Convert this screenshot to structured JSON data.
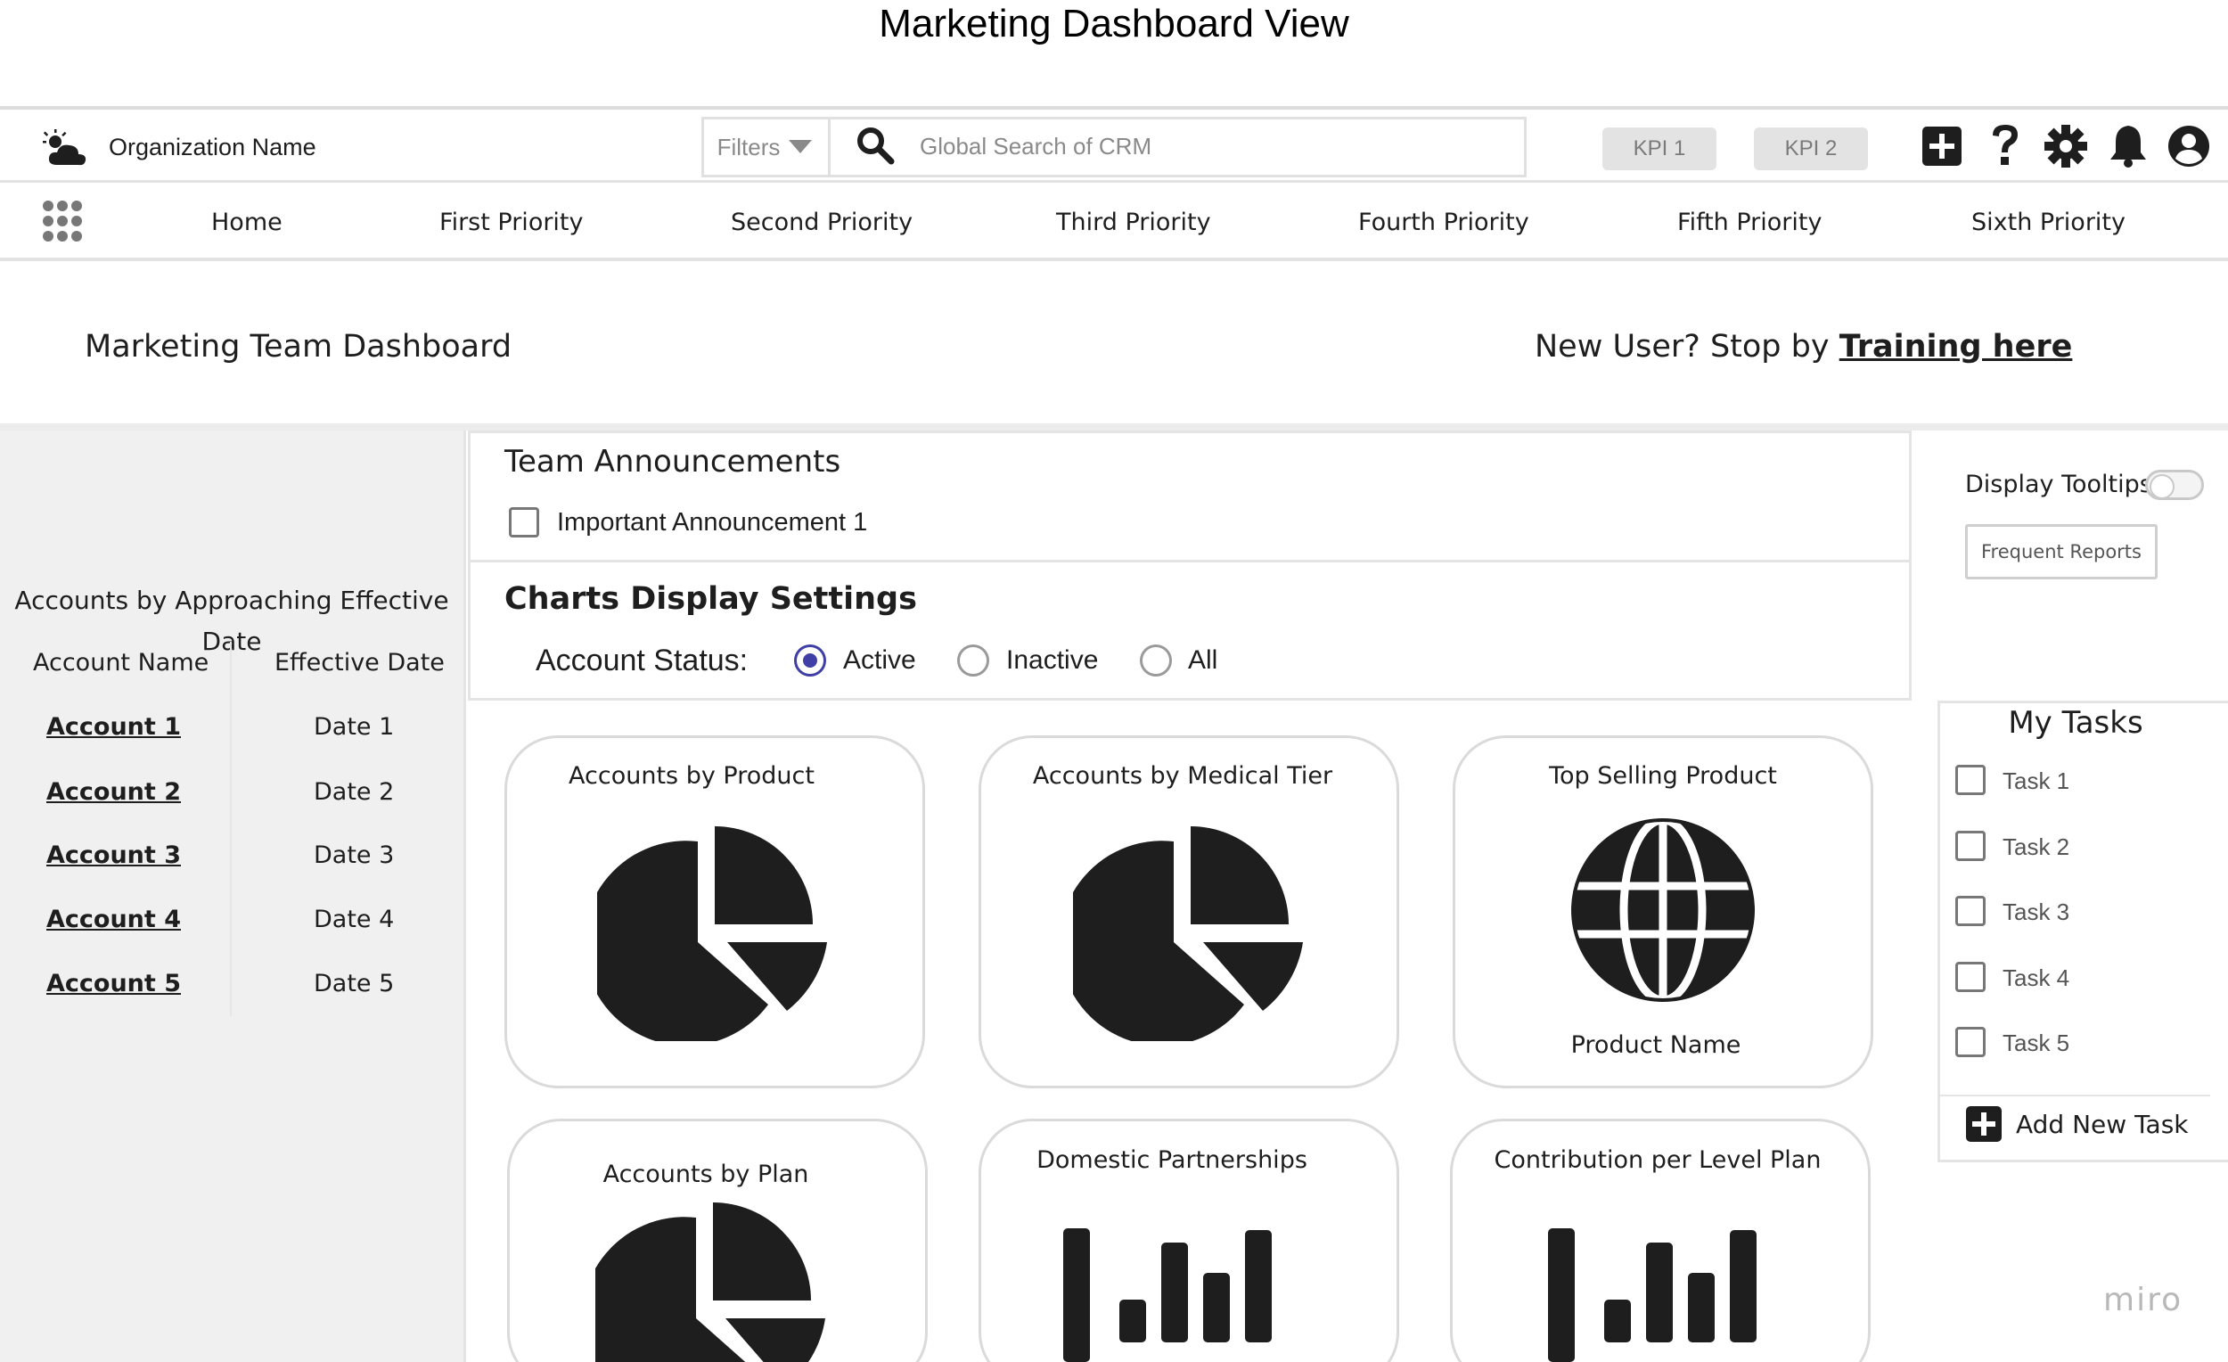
{
  "frame_title": "Marketing Dashboard View",
  "header": {
    "org_name": "Organization Name",
    "filters_label": "Filters",
    "search_placeholder": "Global Search of CRM",
    "kpis": [
      "KPI 1",
      "KPI 2"
    ],
    "icons": [
      "weather-logo-icon",
      "filter-caret-icon",
      "search-icon",
      "plus-icon",
      "help-icon",
      "gear-icon",
      "bell-icon",
      "user-avatar-icon"
    ]
  },
  "nav": {
    "items": [
      "Home",
      "First Priority",
      "Second Priority",
      "Third Priority",
      "Fourth Priority",
      "Fifth Priority",
      "Sixth Priority"
    ]
  },
  "page": {
    "title": "Marketing Team Dashboard",
    "training_prefix": "New User? Stop by ",
    "training_link": "Training here"
  },
  "left_panel": {
    "title": "Accounts by Approaching Effective Date",
    "columns": [
      "Account Name",
      "Effective Date"
    ],
    "rows": [
      {
        "name": "Account 1",
        "date": "Date 1"
      },
      {
        "name": "Account 2",
        "date": "Date 2"
      },
      {
        "name": "Account 3",
        "date": "Date 3"
      },
      {
        "name": "Account 4",
        "date": "Date 4"
      },
      {
        "name": "Account 5",
        "date": "Date 5"
      }
    ]
  },
  "announcements": {
    "title": "Team Announcements",
    "items": [
      "Important Announcement 1"
    ]
  },
  "chart_settings": {
    "title": "Charts Display Settings",
    "status_label": "Account Status:",
    "options": [
      "Active",
      "Inactive",
      "All"
    ],
    "selected": "Active"
  },
  "cards": [
    {
      "title": "Accounts by Product",
      "icon": "pie-chart-icon"
    },
    {
      "title": "Accounts by Medical Tier",
      "icon": "pie-chart-icon"
    },
    {
      "title": "Top Selling Product",
      "icon": "globe-icon",
      "caption": "Product Name"
    },
    {
      "title": "Accounts by Plan",
      "icon": "pie-chart-icon"
    },
    {
      "title": "Domestic Partnerships",
      "icon": "bar-chart-icon"
    },
    {
      "title": "Contribution per Level Plan",
      "icon": "bar-chart-icon"
    }
  ],
  "right_panel": {
    "tooltips_label": "Display Tooltips",
    "tooltips_on": false,
    "frequent_reports_label": "Frequent Reports",
    "tasks_title": "My Tasks",
    "tasks": [
      "Task 1",
      "Task 2",
      "Task 3",
      "Task 4",
      "Task 5"
    ],
    "add_task_label": "Add New Task"
  },
  "watermark": "miro",
  "colors": {
    "accent": "#3f3fa5",
    "icon": "#1e1e1e",
    "panel_bg": "#f0f0f0"
  }
}
